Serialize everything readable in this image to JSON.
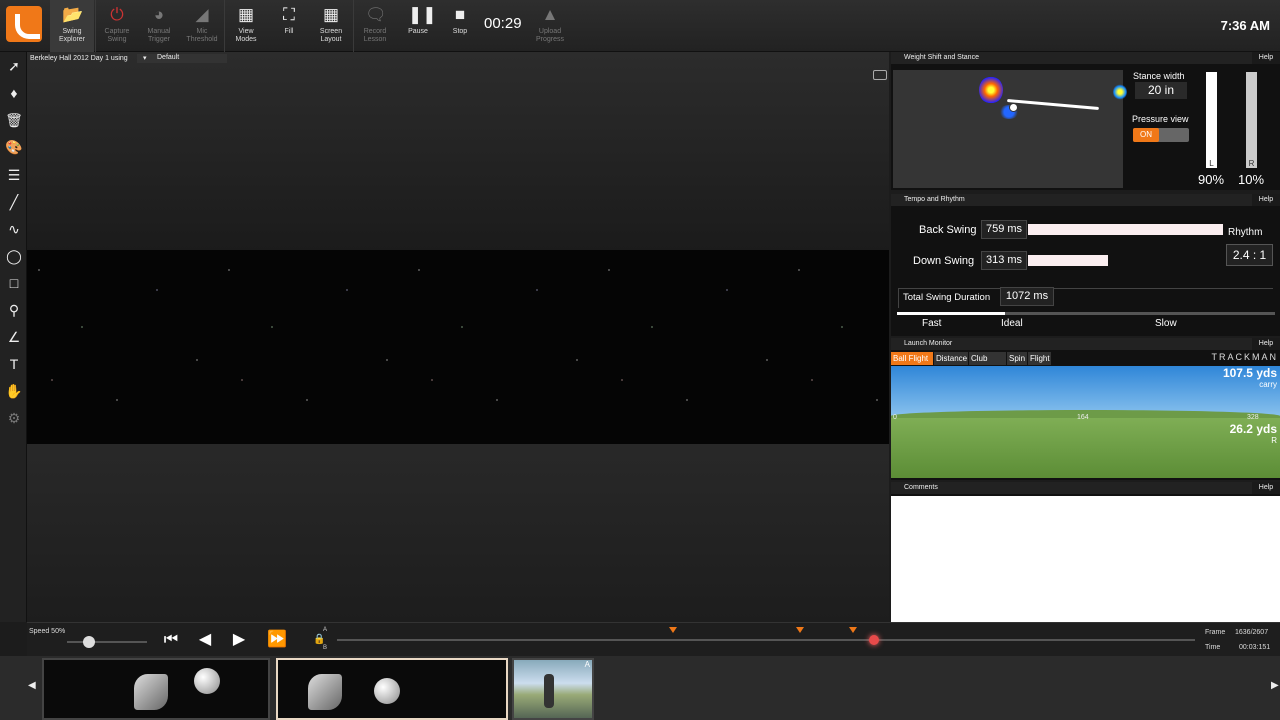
{
  "toolbar": {
    "buttons": [
      {
        "label": "Swing\nExplorer",
        "icon": "folder-icon"
      },
      {
        "label": "Capture\nSwing",
        "icon": "power-icon"
      },
      {
        "label": "Manual\nTrigger",
        "icon": "trigger-icon"
      },
      {
        "label": "Mic\nThreshold",
        "icon": "mic-threshold-icon"
      },
      {
        "label": "View\nModes",
        "icon": "view-modes-icon"
      },
      {
        "label": "Fill",
        "icon": "fill-icon"
      },
      {
        "label": "Screen\nLayout",
        "icon": "screen-layout-icon"
      },
      {
        "label": "Record\nLesson",
        "icon": "record-lesson-icon"
      },
      {
        "label": "Pause",
        "icon": "pause-icon"
      },
      {
        "label": "Stop",
        "icon": "stop-icon"
      },
      {
        "label": "Upload\nProgress",
        "icon": "upload-icon"
      }
    ],
    "timer": "00:29",
    "clock": "7:36 AM"
  },
  "video": {
    "session": "Berkeley Hall 2012 Day 1 using",
    "layout": "Default"
  },
  "weight_panel": {
    "title": "Weight Shift and Stance",
    "help": "Help",
    "stance_label": "Stance width",
    "stance_value": "20 in",
    "pressure_label": "Pressure view",
    "pressure_state": "ON",
    "left_label": "L",
    "right_label": "R",
    "left_pct": "90%",
    "right_pct": "10%",
    "left_fraction": 0.9,
    "right_fraction": 0.1
  },
  "tempo_panel": {
    "title": "Tempo and Rhythm",
    "help": "Help",
    "back_label": "Back Swing",
    "back_value": "759 ms",
    "down_label": "Down Swing",
    "down_value": "313 ms",
    "rhythm_label": "Rhythm",
    "rhythm_value": "2.4 : 1",
    "total_label": "Total Swing Duration",
    "total_value": "1072 ms",
    "scale": [
      "Fast",
      "Ideal",
      "Slow"
    ]
  },
  "launch_panel": {
    "title": "Launch Monitor",
    "help": "Help",
    "tabs": [
      "Ball Flight",
      "Distance",
      "Club Path",
      "Spin",
      "Flight"
    ],
    "brand": "TRACKMAN",
    "carry_value": "107.5 yds",
    "carry_label": "carry",
    "side_value": "26.2 yds",
    "side_label": "R",
    "marker_left": "0",
    "marker_mid": "164",
    "marker_right": "328"
  },
  "comments_panel": {
    "title": "Comments",
    "help": "Help"
  },
  "playback": {
    "speed_label": "Speed 50%",
    "speed_fraction": 0.5,
    "a_label": "A",
    "b_label": "B",
    "frame_label": "Frame",
    "frame_value": "1636/2607",
    "time_label": "Time",
    "time_value": "00:03:151"
  },
  "thumbnails": {
    "badge": "A"
  }
}
